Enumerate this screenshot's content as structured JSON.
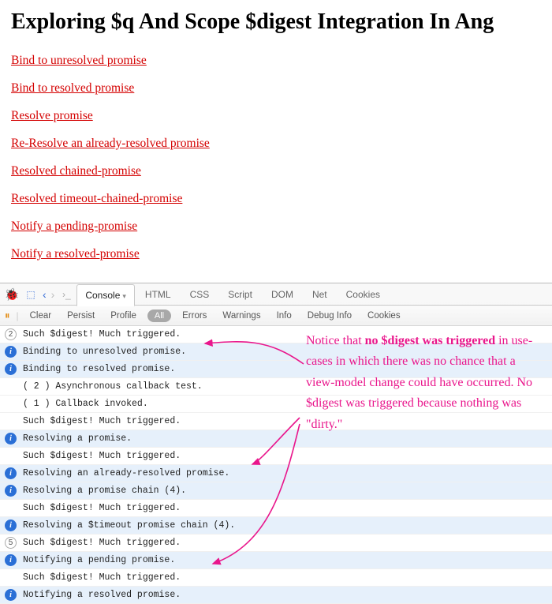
{
  "heading": "Exploring $q And Scope $digest Integration In Ang",
  "links": [
    "Bind to unresolved promise",
    "Bind to resolved promise",
    "Resolve promise",
    "Re-Resolve an already-resolved promise",
    "Resolved chained-promise",
    "Resolved timeout-chained-promise",
    "Notify a pending-promise",
    "Notify a resolved-promise"
  ],
  "tabs": {
    "active": "Console",
    "others": [
      "HTML",
      "CSS",
      "Script",
      "DOM",
      "Net",
      "Cookies"
    ]
  },
  "subbar": {
    "clear": "Clear",
    "persist": "Persist",
    "profile": "Profile",
    "all": "All",
    "errors": "Errors",
    "warnings": "Warnings",
    "info": "Info",
    "debug": "Debug Info",
    "cookies": "Cookies"
  },
  "console": [
    {
      "icon": "count",
      "label": "2",
      "hl": false,
      "msg": "Such $digest! Much triggered."
    },
    {
      "icon": "info",
      "label": "i",
      "hl": true,
      "msg": "Binding to unresolved promise."
    },
    {
      "icon": "info",
      "label": "i",
      "hl": true,
      "msg": "Binding to resolved promise."
    },
    {
      "icon": "blank",
      "label": "",
      "hl": false,
      "msg": "( 2 ) Asynchronous callback test."
    },
    {
      "icon": "blank",
      "label": "",
      "hl": false,
      "msg": "( 1 ) Callback invoked."
    },
    {
      "icon": "blank",
      "label": "",
      "hl": false,
      "msg": "Such $digest! Much triggered."
    },
    {
      "icon": "info",
      "label": "i",
      "hl": true,
      "msg": "Resolving a promise."
    },
    {
      "icon": "blank",
      "label": "",
      "hl": false,
      "msg": "Such $digest! Much triggered."
    },
    {
      "icon": "info",
      "label": "i",
      "hl": true,
      "msg": "Resolving an already-resolved promise."
    },
    {
      "icon": "info",
      "label": "i",
      "hl": true,
      "msg": "Resolving a promise chain (4)."
    },
    {
      "icon": "blank",
      "label": "",
      "hl": false,
      "msg": "Such $digest! Much triggered."
    },
    {
      "icon": "info",
      "label": "i",
      "hl": true,
      "msg": "Resolving a $timeout promise chain (4)."
    },
    {
      "icon": "count",
      "label": "5",
      "hl": false,
      "msg": "Such $digest! Much triggered."
    },
    {
      "icon": "info",
      "label": "i",
      "hl": true,
      "msg": "Notifying a pending promise."
    },
    {
      "icon": "blank",
      "label": "",
      "hl": false,
      "msg": "Such $digest! Much triggered."
    },
    {
      "icon": "info",
      "label": "i",
      "hl": true,
      "msg": "Notifying a resolved promise."
    }
  ],
  "annotation": {
    "pre": "Notice that ",
    "bold": "no $digest was triggered",
    "post": " in use-cases in which there was no chance that a view-model change could have occurred. No $digest was triggered because nothing was \"dirty.\""
  }
}
